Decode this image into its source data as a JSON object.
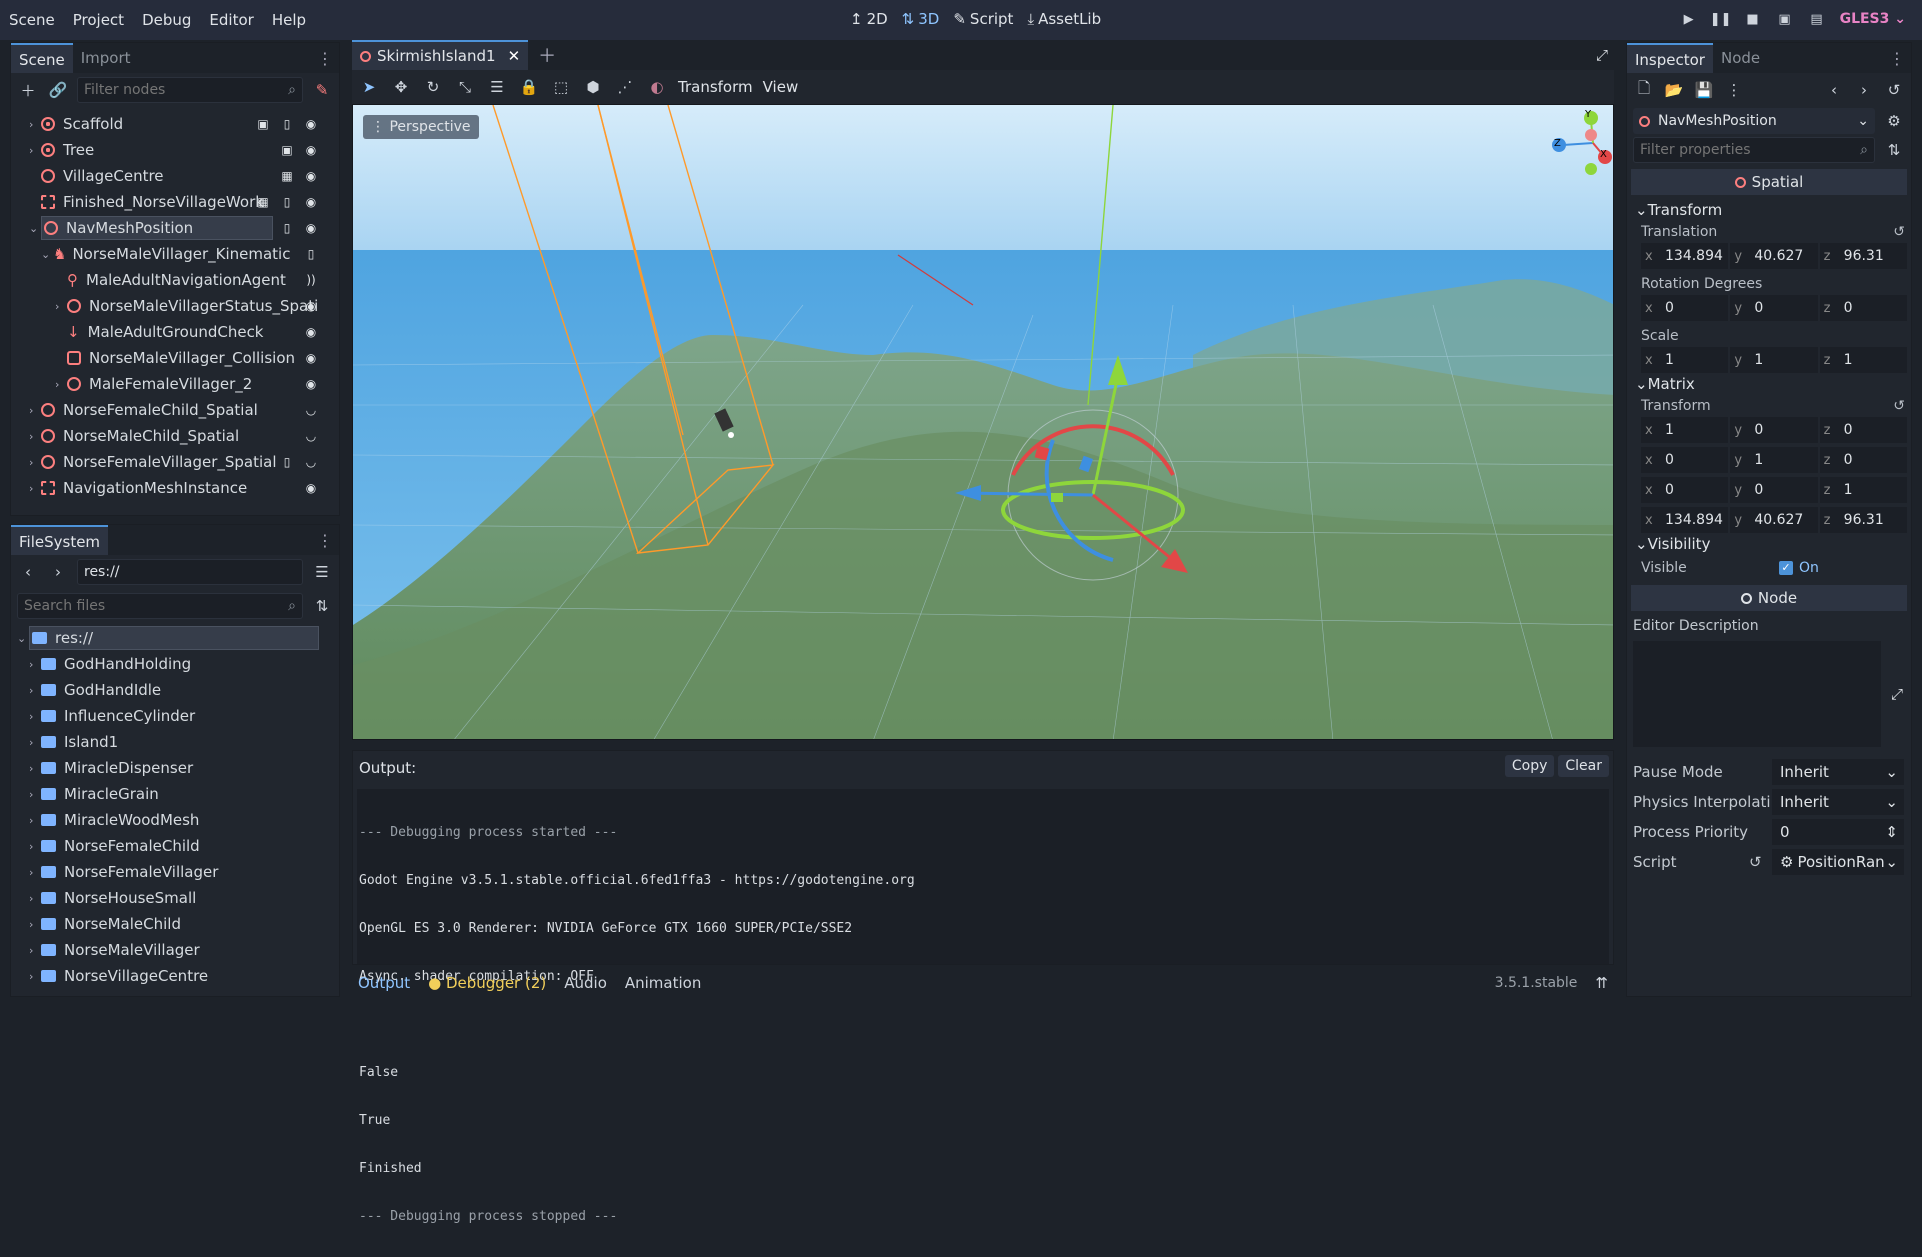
{
  "menu": [
    "Scene",
    "Project",
    "Debug",
    "Editor",
    "Help"
  ],
  "modes": {
    "m2d": "2D",
    "m3d": "3D",
    "script": "Script",
    "assetlib": "AssetLib"
  },
  "renderer": "GLES3",
  "scene_panel": {
    "tabs": {
      "scene": "Scene",
      "import": "Import"
    },
    "filter_placeholder": "Filter nodes",
    "nodes": [
      {
        "label": "Scaffold"
      },
      {
        "label": "Tree"
      },
      {
        "label": "VillageCentre"
      },
      {
        "label": "Finished_NorseVillageWork"
      },
      {
        "label": "NavMeshPosition"
      },
      {
        "label": "NorseMaleVillager_Kinematic"
      },
      {
        "label": "MaleAdultNavigationAgent"
      },
      {
        "label": "NorseMaleVillagerStatus_Spati"
      },
      {
        "label": "MaleAdultGroundCheck"
      },
      {
        "label": "NorseMaleVillager_Collision"
      },
      {
        "label": "MaleFemaleVillager_2"
      },
      {
        "label": "NorseFemaleChild_Spatial"
      },
      {
        "label": "NorseMaleChild_Spatial"
      },
      {
        "label": "NorseFemaleVillager_Spatial"
      },
      {
        "label": "NavigationMeshInstance"
      }
    ]
  },
  "filesystem": {
    "tab": "FileSystem",
    "path": "res://",
    "search_placeholder": "Search files",
    "root": "res://",
    "folders": [
      "GodHandHolding",
      "GodHandIdle",
      "InfluenceCylinder",
      "Island1",
      "MiracleDispenser",
      "MiracleGrain",
      "MiracleWoodMesh",
      "NorseFemaleChild",
      "NorseFemaleVillager",
      "NorseHouseSmall",
      "NorseMaleChild",
      "NorseMaleVillager",
      "NorseVillageCentre"
    ]
  },
  "editor_tab": {
    "name": "SkirmishIsland1"
  },
  "viewport_toolbar": {
    "transform": "Transform",
    "view": "View"
  },
  "viewport": {
    "perspective": "Perspective",
    "gizmo": {
      "y": "Y",
      "x": "X",
      "z": "Z"
    }
  },
  "output": {
    "title": "Output:",
    "copy": "Copy",
    "clear": "Clear",
    "lines": [
      "--- Debugging process started ---",
      "Godot Engine v3.5.1.stable.official.6fed1ffa3 - https://godotengine.org",
      "OpenGL ES 3.0 Renderer: NVIDIA GeForce GTX 1660 SUPER/PCIe/SSE2",
      "Async. shader compilation: OFF",
      "",
      "False",
      "True",
      "Finished",
      "--- Debugging process stopped ---"
    ]
  },
  "bottom_tabs": {
    "output": "Output",
    "debugger": "Debugger (2)",
    "audio": "Audio",
    "animation": "Animation",
    "version": "3.5.1.stable"
  },
  "inspector": {
    "tabs": {
      "inspector": "Inspector",
      "node": "Node"
    },
    "node_name": "NavMeshPosition",
    "filter_placeholder": "Filter properties",
    "class_header": "Spatial",
    "transform_section": "Transform",
    "translation_label": "Translation",
    "translation": {
      "x": "134.894",
      "y": "40.627",
      "z": "96.31"
    },
    "rotation_label": "Rotation Degrees",
    "rotation": {
      "x": "0",
      "y": "0",
      "z": "0"
    },
    "scale_label": "Scale",
    "scale": {
      "x": "1",
      "y": "1",
      "z": "1"
    },
    "matrix_section": "Matrix",
    "matrix_transform_label": "Transform",
    "matrix": [
      {
        "x": "1",
        "y": "0",
        "z": "0"
      },
      {
        "x": "0",
        "y": "1",
        "z": "0"
      },
      {
        "x": "0",
        "y": "0",
        "z": "1"
      },
      {
        "x": "134.894",
        "y": "40.627",
        "z": "96.31"
      }
    ],
    "visibility_section": "Visibility",
    "visible_label": "Visible",
    "visible_value": "On",
    "node_header": "Node",
    "editor_description": "Editor Description",
    "pause_mode_label": "Pause Mode",
    "pause_mode": "Inherit",
    "physics_label": "Physics Interpolati",
    "physics": "Inherit",
    "priority_label": "Process Priority",
    "priority": "0",
    "script_label": "Script",
    "script": "PositionRan"
  },
  "colors": {
    "accent": "#8fc5ff",
    "node_red": "#fc7f7f",
    "folder": "#7fb4ff",
    "sky": "#7fbff0",
    "terrain": "#6f9a72"
  }
}
